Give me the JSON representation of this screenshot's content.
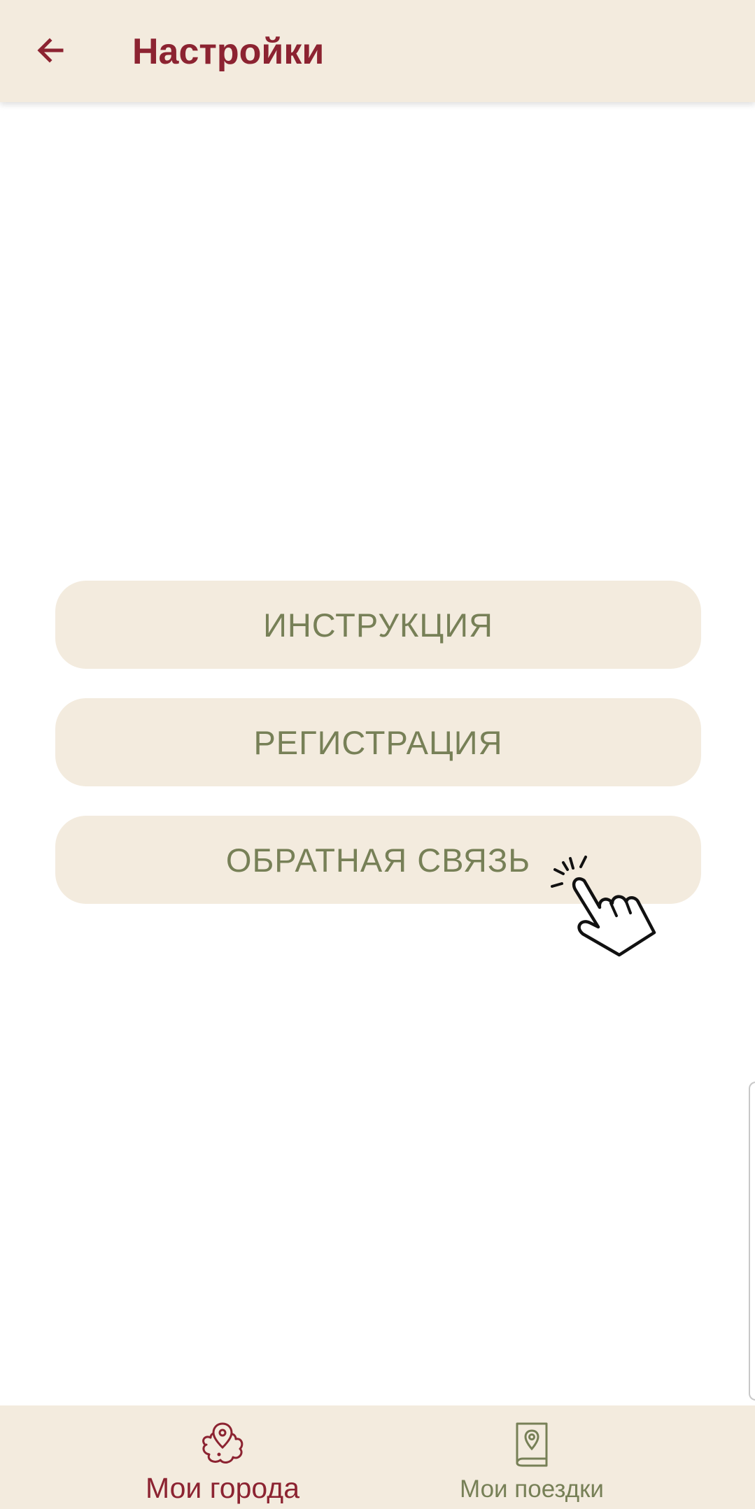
{
  "header": {
    "title": "Настройки",
    "back_icon": "arrow-left-icon"
  },
  "menu": {
    "buttons": [
      {
        "label": "ИНСТРУКЦИЯ"
      },
      {
        "label": "РЕГИСТРАЦИЯ"
      },
      {
        "label": "ОБРАТНАЯ СВЯЗЬ"
      }
    ]
  },
  "bottom_nav": {
    "items": [
      {
        "label": "Мои города",
        "icon": "city-map-pin-icon",
        "active": true
      },
      {
        "label": "Мои поездки",
        "icon": "travel-book-icon",
        "active": false
      }
    ]
  },
  "colors": {
    "accent": "#8c2331",
    "secondary": "#778057",
    "surface": "#f3ebde",
    "background": "#ffffff"
  }
}
